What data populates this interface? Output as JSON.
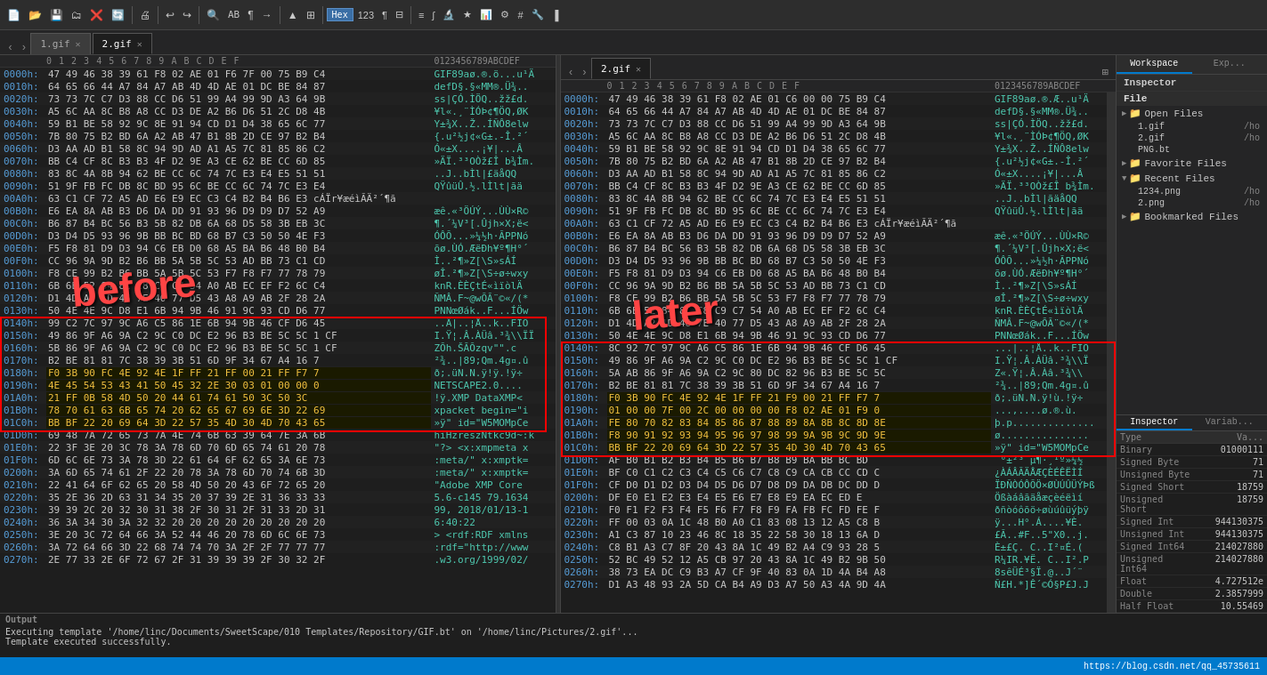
{
  "toolbar": {
    "buttons": [
      {
        "name": "new",
        "icon": "📄"
      },
      {
        "name": "open",
        "icon": "📂"
      },
      {
        "name": "save",
        "icon": "💾"
      },
      {
        "name": "print",
        "icon": "🖨"
      },
      {
        "name": "undo",
        "icon": "↩"
      },
      {
        "name": "redo",
        "icon": "↪"
      },
      {
        "name": "find",
        "icon": "🔍"
      },
      {
        "name": "compare",
        "icon": "⊞"
      },
      {
        "name": "goto",
        "icon": "→"
      },
      {
        "name": "select",
        "icon": "▲"
      },
      {
        "name": "bookmark",
        "icon": "◉"
      },
      {
        "name": "hex",
        "label": "Hex"
      },
      {
        "name": "dec",
        "icon": "D"
      },
      {
        "name": "oct",
        "icon": "O"
      },
      {
        "name": "bin",
        "icon": "B"
      },
      {
        "name": "str",
        "icon": "S"
      },
      {
        "name": "calc",
        "icon": "≡"
      },
      {
        "name": "template",
        "icon": "T"
      },
      {
        "name": "script",
        "icon": "∫"
      },
      {
        "name": "more",
        "icon": "▶"
      }
    ]
  },
  "tabs": {
    "left": {
      "nav_prev": "‹",
      "nav_next": "›",
      "items": [
        {
          "id": "tab1",
          "label": "1.gif",
          "active": false
        },
        {
          "id": "tab2",
          "label": "2.gif",
          "active": true
        }
      ]
    }
  },
  "hex_panel_left": {
    "title": "1.gif",
    "col_header": "  0  1  2  3  4  5  6  7  8  9  A  B  C  D  E  F   0123456789ABCDEF",
    "rows": [
      {
        "addr": "0000h:",
        "bytes": "47 49 46 38 39 61 F8 02 AE 01 F6 7F 00 75 B9 C4",
        "ascii": "GIF89aø.®.ö...u¹Ä"
      },
      {
        "addr": "0010h:",
        "bytes": "64 65 66 44 A7 84 A7 AB 4D 4D AE 01 DC BE 84 87",
        "ascii": "defD§.§«MM®.Ü¾.."
      },
      {
        "addr": "0020h:",
        "bytes": "73 73 7C C7 D3 88 CC D6 51 99 A4 99 9D A3 64 9B",
        "ascii": "ss|ÇÓ.ÌÖQ..žž£d."
      },
      {
        "addr": "0030h:",
        "bytes": "A5 6C AA 8C B8 A8 CC D3 DE A2 B6 D6 51 2C D8 4B",
        "ascii": "¥l«.¸¨ÌÓÞ¢¶ÖQ,ØK"
      },
      {
        "addr": "0040h:",
        "bytes": "59 B1 BE 58 92 9C 8E 91 94 CD D1 D4 38 65 6C 77",
        "ascii": "Y±¾X..Ž..ÍÑÔ8elw"
      },
      {
        "addr": "0050h:",
        "bytes": "7B 80 75 B2 BD 6A A2 AB 47 B1 8B 2D CE 97 B2 B4",
        "ascii": "{.u²½j¢«G±.-Î.²´"
      },
      {
        "addr": "0060h:",
        "bytes": "D3 AA AD B1 58 8C 94 9D AD A1 A5 7C 81 85 86 C2",
        "ascii": "Ó«­±X....¡¥|...Â"
      },
      {
        "addr": "0070h:",
        "bytes": "BB C4 CF 8C B3 B3 4F D2 9E A3 CE 62 BE CC 6D 85",
        "ascii": "»ÄÏ.³³OÒž£Î b¾Ìm."
      },
      {
        "addr": "0080h:",
        "bytes": "83 8C 4A 8B 94 62 BE CC 6C 74 7C E3 E4 E5 51 51",
        "ascii": "..J..bÌl|£äåQQ"
      },
      {
        "addr": "0090h:",
        "bytes": "51 9F FB FC DB 8C BD 95 6C BE CC 6C 74 7C E3 E4",
        "ascii": "QŸûüÛ.½.lÌlt|ãä"
      },
      {
        "addr": "00A0h:",
        "bytes": "63 C1 CF 72 A5 AD E6 E9 EC C3 C4 B2 B4 B6 E3 cÁÏr¥­æéìÃÄ²´¶ã"
      },
      {
        "addr": "00B0h:",
        "bytes": "E6 EA 8A AB B3 D6 DA DD 91 93 96 D9 D9 D7 52 A9",
        "ascii": "æê.«³ÖÚÝ...ÙÙ×R©"
      },
      {
        "addr": "00C0h:",
        "bytes": "B6 87 B4 BC 56 B3 5B 82 DB 6A 68 D5 58 3B EB 3C",
        "ascii": "¶.´¼V³[.Ûjh×X;ë<"
      },
      {
        "addr": "00D0h:",
        "bytes": "D3 D4 D5 93 96 9B BB BC BD 68 B7 C3 50 50 4E F3",
        "ascii": "ÓÔÕ...»¼½h·ÃPPNó"
      },
      {
        "addr": "00E0h:",
        "bytes": "F5 F8 81 D9 D3 94 C6 EB D0 68 A5 BA B6 48 B0 B4",
        "ascii": "õø.ÙÓ.ÆëÐh¥º¶H°´"
      },
      {
        "addr": "00F0h:",
        "bytes": "CC 96 9A 9D B2 B6 BB 5A 5B 5C 53 AD BB 73 C1 CD",
        "ascii": "Ì..²¶»Z[\\S­»sÁÍ"
      },
      {
        "addr": "0100h:",
        "bytes": "F8 CE 99 B2 B6 BB 5A 5B 5C 53 F7 F8 F7 77 78 79",
        "ascii": "øÎ.²¶»Z[\\S÷ø÷wxy"
      },
      {
        "addr": "0110h:",
        "bytes": "6B 6E 52 84 8C C8 C9 C7 54 A0 AB EC EF F2 6C C4",
        "ascii": "knR.ÈÈÇtÉ«ìïòlÄ"
      },
      {
        "addr": "0120h:",
        "bytes": "D1 4D A2 1D 46 7E 40 77 D5 43 A8 A9 AB 2F 28 2A",
        "ascii": "ÑMÂ.F~@wÕÃ¨©«/(* "
      },
      {
        "addr": "0130h:",
        "bytes": "50 4E 4E 9C D8 E1 6B 94 9B 46 91 9C 93 CD D6 77",
        "ascii": "PNNœØák..F...ÍÖw"
      },
      {
        "addr": "0140h:",
        "bytes": "99 C2 7C 97 9C A6 C5 86 1E 6B 94 9B 46 CF D6 45",
        "ascii": "..Â|..¦Å..k..FÏÖ"
      },
      {
        "addr": "0150h:",
        "bytes": "49 86 9F A6 9A C2 9C C0 DC E2 96 B3 BE 5C 5C 1 CF",
        "ascii": "I.Ÿ¦.Â.ÀÜâ.³¾\\\\ÏÏ"
      },
      {
        "addr": "0160h:",
        "bytes": "5B 86 9F A6 9A C2 9C C0 DC E2 96 B3 BE 5C 5C 1 CF",
        "ascii": "ZÕh.ŠÃÕzqv\"\".c"
      },
      {
        "addr": "0170h:",
        "bytes": "B2 BE 81 81 7C 38 39 3B 51 6D 9F 34 67 A4 16 7",
        "ascii": "²¾..|89;Qm.4g¤.û"
      },
      {
        "addr": "0180h:",
        "bytes": "F0 3B 90 FC 4E 92 4E 1F FF 21 FF 00 21 FF F7 7",
        "ascii": "ð;.üN.N.ÿ!ÿ.!ÿ÷"
      },
      {
        "addr": "0190h:",
        "bytes": "4E 45 54 53 43 41 50 45 32 2E 30 03 01 00 00 0",
        "ascii": "NETSCAPE2.0...."
      },
      {
        "addr": "01A0h:",
        "bytes": "21 FF 0B 58 4D 50 20 44 61 74 61 50 3C 50 3C",
        "ascii": "!ÿ.XMP DataXMP<"
      },
      {
        "addr": "01B0h:",
        "bytes": "78 70 61 63 6B 65 74 20 62 65 67 69 6E 3D 22 69",
        "ascii": "xpacket begin=\"i"
      },
      {
        "addr": "01C0h:",
        "bytes": "BB BF 22 20 69 64 3D 22 57 35 4D 30 4D 70 43 65",
        "ascii": "»ÿ\" id=\"W5MOMpCe"
      },
      {
        "addr": "01D0h:",
        "bytes": "69 48 7A 72 65 73 7A 4E 74 6B 63 39 64 7E 3A 6B",
        "ascii": "hiHzreszNtkc9d~:k"
      },
      {
        "addr": "01E0h:",
        "bytes": "22 3F 3E 20 3C 78 3A 78 6D 70 6D 65 74 61 20 78",
        "ascii": "\"?> <x:xmpmeta x"
      },
      {
        "addr": "01F0h:",
        "bytes": "6D 6C 6E 73 3A 78 3D 22 61 64 6F 62 65 3A 6E 73",
        "ascii": ":meta/\" x:xmptk="
      },
      {
        "addr": "0200h:",
        "bytes": "3A 6D 65 74 61 2F 22 20 78 3A 78 6D 70 74 6B 3D",
        "ascii": ":meta/\" x:xmptk="
      },
      {
        "addr": "0210h:",
        "bytes": "22 41 64 6F 62 65 20 58 4D 50 20 43 6F 72 65 20",
        "ascii": "\"Adobe XMP Core "
      },
      {
        "addr": "0220h:",
        "bytes": "35 2E 36 2D 63 31 34 35 20 37 39 2E 31 36 33 33",
        "ascii": "5.6-c145 79.1634"
      },
      {
        "addr": "0230h:",
        "bytes": "39 39 2C 20 32 30 31 38 2F 30 31 2F 31 33 2D 31",
        "ascii": "99, 2018/01/13-1"
      },
      {
        "addr": "0240h:",
        "bytes": "36 3A 34 30 3A 32 32 20 20 20 20 20 20 20 20 20",
        "ascii": "6:40:22         "
      },
      {
        "addr": "0250h:",
        "bytes": "3E 20 3C 72 64 66 3A 52 44 46 20 78 6D 6C 6E 73",
        "ascii": "> <rdf:RDF xmlns"
      },
      {
        "addr": "0260h:",
        "bytes": "3A 72 64 66 3D 22 68 74 74 70 3A 2F 2F 77 77 77",
        "ascii": ":rdf=\"http://www"
      },
      {
        "addr": "0270h:",
        "bytes": "2E 77 33 2E 6F 72 67 2F 31 39 39 39 2F 30 32 2F",
        "ascii": ".w3.org/1999/02/"
      }
    ]
  },
  "hex_panel_right": {
    "title": "2.gif",
    "rows": [
      {
        "addr": "0000h:",
        "bytes": "47 49 46 38 39 61 F8 02 AE 01 C6 00 00 75 B9 C4",
        "ascii": "GIF89aø.®.Æ..u¹Ä"
      },
      {
        "addr": "0010h:",
        "bytes": "64 65 66 44 A7 84 A7 AB 4D 4D AE 01 DC BE 84 87",
        "ascii": "defD§.§«MM®.Ü¾.."
      },
      {
        "addr": "0020h:",
        "bytes": "73 73 7C C7 D3 88 CC D6 51 99 A4 99 9D A3 64 9B",
        "ascii": "ss|ÇÓ.ÌÖQ..žž£d."
      },
      {
        "addr": "0030h:",
        "bytes": "A5 6C AA 8C B8 A8 CC D3 DE A2 B6 D6 51 2C D8 4B",
        "ascii": "¥l«.¸¨ÌÓÞ¢¶ÖQ,ØK"
      },
      {
        "addr": "0040h:",
        "bytes": "59 B1 BE 58 92 9C 8E 91 94 CD D1 D4 38 65 6C 77",
        "ascii": "Y±¾X..Ž..ÍÑÔ8elw"
      },
      {
        "addr": "0050h:",
        "bytes": "7B 80 75 B2 BD 6A A2 AB 47 B1 8B 2D CE 97 B2 B4",
        "ascii": "{.u²½j¢«G±.-Î.²´"
      },
      {
        "addr": "0060h:",
        "bytes": "D3 AA AD B1 58 8C 94 9D AD A1 A5 7C 81 85 86 C2",
        "ascii": "Ó«­±X....¡¥|...Â"
      },
      {
        "addr": "0070h:",
        "bytes": "BB C4 CF 8C B3 B3 4F D2 9E A3 CE 62 BE CC 6D 85",
        "ascii": "»ÄÏ.³³OÒž£Î b¾Ìm."
      },
      {
        "addr": "0080h:",
        "bytes": "83 8C 4A 8B 94 62 BE CC 6C 74 7C E3 E4 E5 51 51",
        "ascii": "..J..bÌl|ãäåQQ"
      },
      {
        "addr": "0090h:",
        "bytes": "51 9F FB FC DB 8C BD 95 6C BE CC 6C 74 7C E3 E4",
        "ascii": "QŸûüÛ.½.lÌlt|ãä"
      },
      {
        "addr": "00A0h:",
        "bytes": "63 C1 CF 72 A5 AD E6 E9 EC C3 C4 B2 B4 B6 E3 cÁÏr¥­æéìÃÄ²´¶ã"
      },
      {
        "addr": "00B0h:",
        "bytes": "E6 EA 8A AB B3 D6 DA DD 91 93 96 D9 D9 D7 52 A9",
        "ascii": "æê.«³ÖÚÝ...ÙÙ×R©"
      },
      {
        "addr": "00C0h:",
        "bytes": "B6 87 B4 BC 56 B3 5B 82 DB 6A 68 D5 58 3B EB 3C",
        "ascii": "¶.´¼V³[.Ûjh×X;ë<"
      },
      {
        "addr": "00D0h:",
        "bytes": "D3 D4 D5 93 96 9B BB BC BD 68 B7 C3 50 50 4E F3",
        "ascii": "ÓÔÕ...»¼½h·ÃPPNó"
      },
      {
        "addr": "00E0h:",
        "bytes": "F5 F8 81 D9 D3 94 C6 EB D0 68 A5 BA B6 48 B0 B4",
        "ascii": "õø.ÙÓ.ÆëÐh¥º¶H°´"
      },
      {
        "addr": "00F0h:",
        "bytes": "CC 96 9A 9D B2 B6 BB 5A 5B 5C 53 AD BB 73 C1 CD",
        "ascii": "Ì..²¶»Z[\\S­»sÁÍ"
      },
      {
        "addr": "0100h:",
        "bytes": "F8 CE 99 B2 B6 BB 5A 5B 5C 53 F7 F8 F7 77 78 79",
        "ascii": "øÎ.²¶»Z[\\S÷ø÷wxy"
      },
      {
        "addr": "0110h:",
        "bytes": "6B 6E 52 84 8C C8 C9 C7 54 A0 AB EC EF F2 6C C4",
        "ascii": "knR.ÈÈÇtÉ«ìïòlÄ"
      },
      {
        "addr": "0120h:",
        "bytes": "D1 4D A2 1D 46 7E 40 77 D5 43 A8 A9 AB 2F 28 2A",
        "ascii": "ÑMÂ.F~@wÕÃ¨©«/(* "
      },
      {
        "addr": "0130h:",
        "bytes": "50 4E 4E 9C D8 E1 6B 94 9B 46 91 9C 93 CD D6 77",
        "ascii": "PNNœØák..F...ÍÖw"
      },
      {
        "addr": "0140h:",
        "bytes": "8C 92 7C 97 9C A6 C5 86 1E 6B 94 9B 46 CF D6 45",
        "ascii": "...|..¦Å..k..FÏÖ"
      },
      {
        "addr": "0150h:",
        "bytes": "49 86 9F A6 9A C2 9C C0 DC E2 96 B3 BE 5C 5C 1 CF",
        "ascii": "I.Ÿ¦.Â.ÀÜâ.³¾\\\\Ï"
      },
      {
        "addr": "0160h:",
        "bytes": "5A AB 86 9F A6 9A C2 9C 80 DC 82 96 B3 BE 5C 5C",
        "ascii": "Z«.Ÿ¦.Â.Àâ.³¾\\\\"
      },
      {
        "addr": "0170h:",
        "bytes": "B2 BE 81 81 7C 38 39 3B 51 6D 9F 34 67 A4 16 7",
        "ascii": "²¾..|89;Qm.4g¤.û"
      },
      {
        "addr": "0180h:",
        "bytes": "F0 3B 90 FC 4E 92 4E 1F FF 21 F9 00 21 FF F7 7",
        "ascii": "ð;.üN.N.ÿ!ù.!ÿ÷"
      },
      {
        "addr": "0190h:",
        "bytes": "01 00 00 7F 00 2C 00 00 00 00 F8 02 AE 01 F9 0",
        "ascii": "...,....ø.®.ù."
      },
      {
        "addr": "01A0h:",
        "bytes": "FE 80 70 82 83 84 85 86 87 88 89 8A 8B 8C 8D 8E",
        "ascii": "þ.p.............."
      },
      {
        "addr": "01B0h:",
        "bytes": "F8 90 91 92 93 94 95 96 97 98 99 9A 9B 9C 9D 9E",
        "ascii": "ø..............."
      },
      {
        "addr": "01C0h:",
        "bytes": "BB BF 22 20 69 64 3D 22 57 35 4D 30 4D 70 43 65",
        "ascii": "»ÿ\" id=\"W5MOMpCe"
      },
      {
        "addr": "01D0h:",
        "bytes": "AF B0 B1 B2 B3 B4 B5 B6 B7 B8 B9 BA BB BC BD",
        "ascii": "¯°±²³´µ¶·¸¹º»¼½"
      },
      {
        "addr": "01E0h:",
        "bytes": "BF C0 C1 C2 C3 C4 C5 C6 C7 C8 C9 CA CB CC CD C",
        "ascii": "¿ÀÁÂÃÄÅÆÇÈÉÊËÌÍ"
      },
      {
        "addr": "01F0h:",
        "bytes": "CF D0 D1 D2 D3 D4 D5 D6 D7 D8 D9 DA DB DC DD D",
        "ascii": "ÏÐÑÒÓÔÕÖ×ØÙÚÛÜÝÞß"
      },
      {
        "addr": "0200h:",
        "bytes": "DF E0 E1 E2 E3 E4 E5 E6 E7 E8 E9 EA EC ED E",
        "ascii": "Ößàáâãäåæçèéëìí"
      },
      {
        "addr": "0210h:",
        "bytes": "F0 F1 F2 F3 F4 F5 F6 F7 F8 F9 FA FB FC FD FE F",
        "ascii": "ðñòóôõö÷øùúûüýþÿ"
      },
      {
        "addr": "0220h:",
        "bytes": "FF 00 03 0A 1C 48 B0 A0 C1 83 08 13 12 A5 C8 B",
        "ascii": "ÿ...H°.Á....¥È."
      },
      {
        "addr": "0230h:",
        "bytes": "A1 C3 87 10 23 46 8C 18 35 22 58 30 18 13 6A D",
        "ascii": "£Ã..#F..5\"X0..j."
      },
      {
        "addr": "0240h:",
        "bytes": "C8 B1 A3 C7 8F 20 43 8A 1C 49 B2 A4 C9 93 28 5",
        "ascii": "È±£Ç. C..I²¤É.("
      },
      {
        "addr": "0250h:",
        "bytes": "52 BC 49 52 12 A5 CB 97 20 43 8A 1C 49 B2 9B 50",
        "ascii": "R¼IR.¥Ë. C..I².P"
      },
      {
        "addr": "0260h:",
        "bytes": "38 73 EA DC C9 B3 A7 CF 9F 40 83 0A 1D 4A B4 A8",
        "ascii": "8sêÜÉ³§Ï.@..J´¨"
      },
      {
        "addr": "0270h:",
        "bytes": "D1 A3 48 93 2A 5D CA B4 A9 D3 A7 50 A3 4A 9D 4A",
        "ascii": "Ñ£H.*]Ê´©Ó§P£J.J"
      }
    ]
  },
  "workspace_sidebar": {
    "title": "Workspace",
    "sections": [
      {
        "title": "File",
        "items": [
          {
            "label": "Open Files",
            "icon": "folder"
          },
          {
            "label": "1.gif",
            "path": "/ho",
            "sub": true
          },
          {
            "label": "2.gif",
            "path": "/ho",
            "sub": true
          },
          {
            "label": "PNG.bt",
            "sub": true
          },
          {
            "label": "Favorite Files",
            "icon": "folder"
          },
          {
            "label": "Recent Files",
            "icon": "folder"
          },
          {
            "label": "1234.png",
            "sub": true
          },
          {
            "label": "2.png",
            "sub": true
          },
          {
            "label": "Bookmarked Files",
            "icon": "folder"
          }
        ]
      }
    ]
  },
  "inspector": {
    "title": "Inspector",
    "tab_inspector": "Inspector",
    "tab_variables": "Variab...",
    "rows": [
      {
        "type": "Binary",
        "value": "01000111"
      },
      {
        "type": "Signed Byte",
        "value": "71"
      },
      {
        "type": "Unsigned Byte",
        "value": "71"
      },
      {
        "type": "Signed Short",
        "value": "18759"
      },
      {
        "type": "Unsigned Short",
        "value": "18759"
      },
      {
        "type": "Signed Int",
        "value": "944130375"
      },
      {
        "type": "Unsigned Int",
        "value": "944130375"
      },
      {
        "type": "Signed Int64",
        "value": "214027880"
      },
      {
        "type": "Unsigned Int64",
        "value": "214027880"
      },
      {
        "type": "Float",
        "value": "4.727512e"
      },
      {
        "type": "Double",
        "value": "2.3857999"
      },
      {
        "type": "Half Float",
        "value": "10.55469"
      }
    ],
    "bottom_tab_inspector": "Inspector",
    "bottom_tab_variables": "Variab..."
  },
  "output": {
    "label": "Output",
    "line1": "Executing template '/home/linc/Documents/SweetScape/010 Templates/Repository/GIF.bt' on '/home/linc/Pictures/2.gif'...",
    "line2": "Template executed successfully."
  },
  "statusbar": {
    "url": "https://blog.csdn.net/qq_45735611"
  },
  "annotations": {
    "before": "before",
    "later": "later"
  },
  "selected_bytes": {
    "left_box": {
      "row_start": 24,
      "label": "selected region left"
    },
    "right_box": {
      "row_start": 24,
      "label": "selected region right"
    }
  }
}
